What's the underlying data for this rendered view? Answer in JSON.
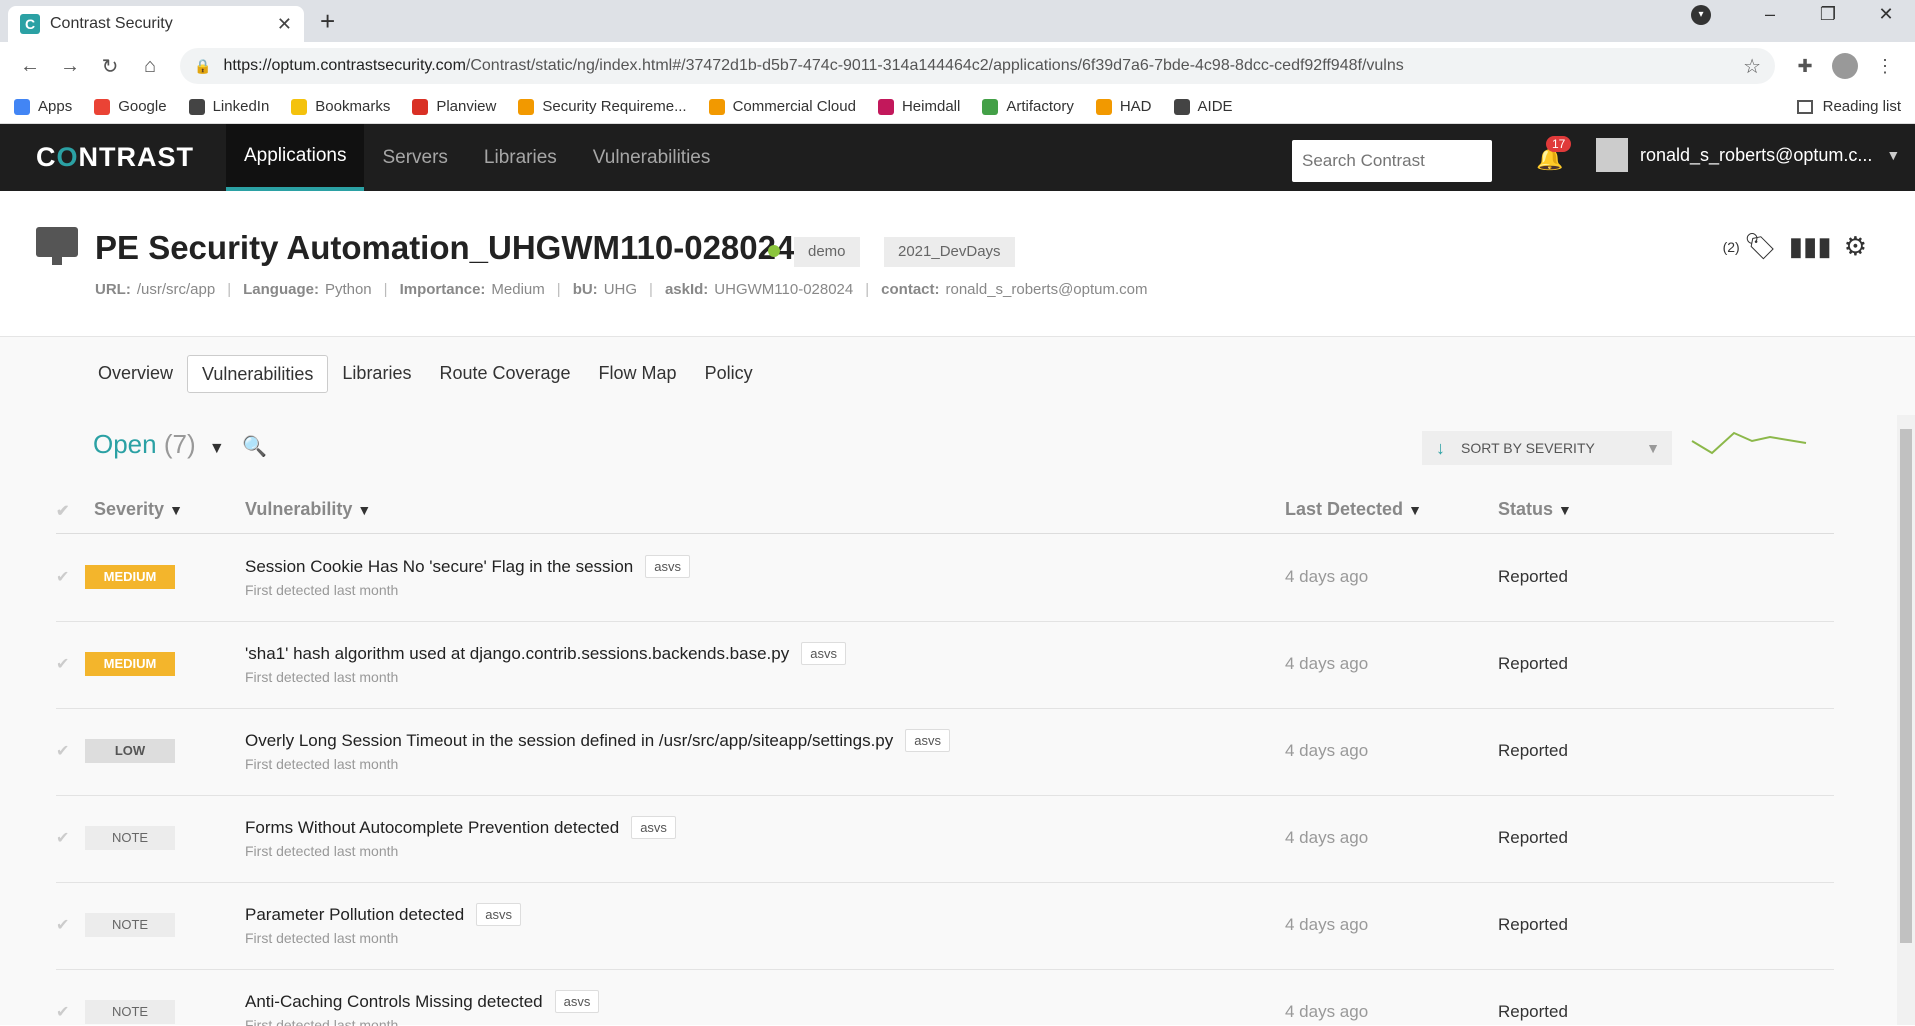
{
  "browser": {
    "tab_title": "Contrast Security",
    "url_host": "https://optum.contrastsecurity.com",
    "url_path": "/Contrast/static/ng/index.html#/37472d1b-d5b7-474c-9011-314a144464c2/applications/6f39d7a6-7bde-4c98-8dcc-cedf92ff948f/vulns",
    "bookmarks": [
      {
        "label": "Apps",
        "color": "#4285f4"
      },
      {
        "label": "Google",
        "color": "#ea4335"
      },
      {
        "label": "LinkedIn",
        "color": "#444444"
      },
      {
        "label": "Bookmarks",
        "color": "#f4c20d"
      },
      {
        "label": "Planview",
        "color": "#d93025"
      },
      {
        "label": "Security Requireme...",
        "color": "#f29900"
      },
      {
        "label": "Commercial Cloud",
        "color": "#f29900"
      },
      {
        "label": "Heimdall",
        "color": "#c2185b"
      },
      {
        "label": "Artifactory",
        "color": "#43a047"
      },
      {
        "label": "HAD",
        "color": "#f29900"
      },
      {
        "label": "AIDE",
        "color": "#444444"
      }
    ],
    "reading_list": "Reading list"
  },
  "topnav": {
    "logo": "CONTRAST",
    "items": [
      "Applications",
      "Servers",
      "Libraries",
      "Vulnerabilities"
    ],
    "search_placeholder": "Search Contrast",
    "notifications": "17",
    "user": "ronald_s_roberts@optum.c..."
  },
  "app": {
    "title": "PE Security Automation_UHGWM110-028024",
    "tags": [
      "demo",
      "2021_DevDays"
    ],
    "tag_count": "(2)",
    "meta": [
      {
        "k": "URL:",
        "v": "/usr/src/app"
      },
      {
        "k": "Language:",
        "v": "Python"
      },
      {
        "k": "Importance:",
        "v": "Medium"
      },
      {
        "k": "bU:",
        "v": "UHG"
      },
      {
        "k": "askId:",
        "v": "UHGWM110-028024"
      },
      {
        "k": "contact:",
        "v": "ronald_s_roberts@optum.com"
      }
    ]
  },
  "subtabs": [
    "Overview",
    "Vulnerabilities",
    "Libraries",
    "Route Coverage",
    "Flow Map",
    "Policy"
  ],
  "filter": {
    "label": "Open",
    "count": "(7)"
  },
  "sort": {
    "label": "SORT BY SEVERITY"
  },
  "table": {
    "headers": {
      "severity": "Severity",
      "vulnerability": "Vulnerability",
      "last_detected": "Last Detected",
      "status": "Status"
    },
    "rows": [
      {
        "severity": "MEDIUM",
        "level": "medium",
        "name": "Session Cookie Has No 'secure' Flag in the session",
        "tag": "asvs",
        "sub": "First detected last month",
        "detected": "4 days ago",
        "status": "Reported"
      },
      {
        "severity": "MEDIUM",
        "level": "medium",
        "name": "'sha1' hash algorithm used at django.contrib.sessions.backends.base.py",
        "tag": "asvs",
        "sub": "First detected last month",
        "detected": "4 days ago",
        "status": "Reported"
      },
      {
        "severity": "LOW",
        "level": "low",
        "name": "Overly Long Session Timeout in the session defined in /usr/src/app/siteapp/settings.py",
        "tag": "asvs",
        "sub": "First detected last month",
        "detected": "4 days ago",
        "status": "Reported"
      },
      {
        "severity": "NOTE",
        "level": "note",
        "name": "Forms Without Autocomplete Prevention detected",
        "tag": "asvs",
        "sub": "First detected last month",
        "detected": "4 days ago",
        "status": "Reported"
      },
      {
        "severity": "NOTE",
        "level": "note",
        "name": "Parameter Pollution detected",
        "tag": "asvs",
        "sub": "First detected last month",
        "detected": "4 days ago",
        "status": "Reported"
      },
      {
        "severity": "NOTE",
        "level": "note",
        "name": "Anti-Caching Controls Missing detected",
        "tag": "asvs",
        "sub": "First detected last month",
        "detected": "4 days ago",
        "status": "Reported"
      }
    ]
  },
  "colors": {
    "accent": "#2ba1a4",
    "medium": "#f3b52c",
    "alert": "#e03a3a",
    "active_dot": "#8cc63e"
  }
}
